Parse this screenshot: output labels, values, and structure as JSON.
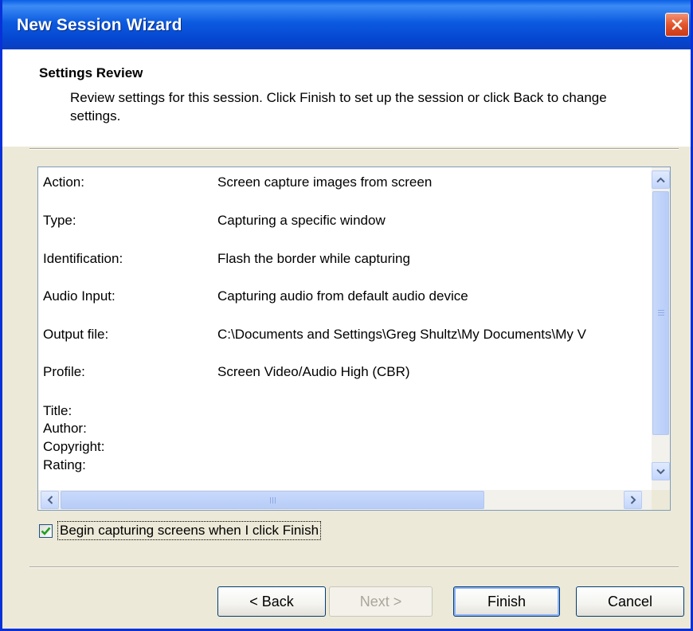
{
  "window": {
    "title": "New Session Wizard",
    "accent": "#0a5fe6",
    "close_color": "#e3552c"
  },
  "header": {
    "title": "Settings Review",
    "description": "Review settings for this session. Click Finish to set up the session or click Back to change settings."
  },
  "settings": [
    {
      "label": "Action:",
      "value": "Screen capture images from screen"
    },
    {
      "label": "Type:",
      "value": "Capturing a specific window"
    },
    {
      "label": "Identification:",
      "value": "Flash the border while capturing"
    },
    {
      "label": "Audio Input:",
      "value": "Capturing audio from default audio device"
    },
    {
      "label": "Output file:",
      "value": "C:\\Documents and Settings\\Greg Shultz\\My Documents\\My V"
    },
    {
      "label": "Profile:",
      "value": "Screen Video/Audio High (CBR)"
    }
  ],
  "metadata_labels": [
    "Title:",
    "Author:",
    "Copyright:",
    "Rating:"
  ],
  "checkbox": {
    "label": "Begin capturing screens when I click Finish",
    "checked": true
  },
  "buttons": {
    "back": "< Back",
    "next": "Next >",
    "finish": "Finish",
    "cancel": "Cancel"
  },
  "icons": {
    "close": "close-icon",
    "scroll_up": "chevron-up-icon",
    "scroll_down": "chevron-down-icon",
    "scroll_left": "chevron-left-icon",
    "scroll_right": "chevron-right-icon",
    "check": "check-icon"
  }
}
